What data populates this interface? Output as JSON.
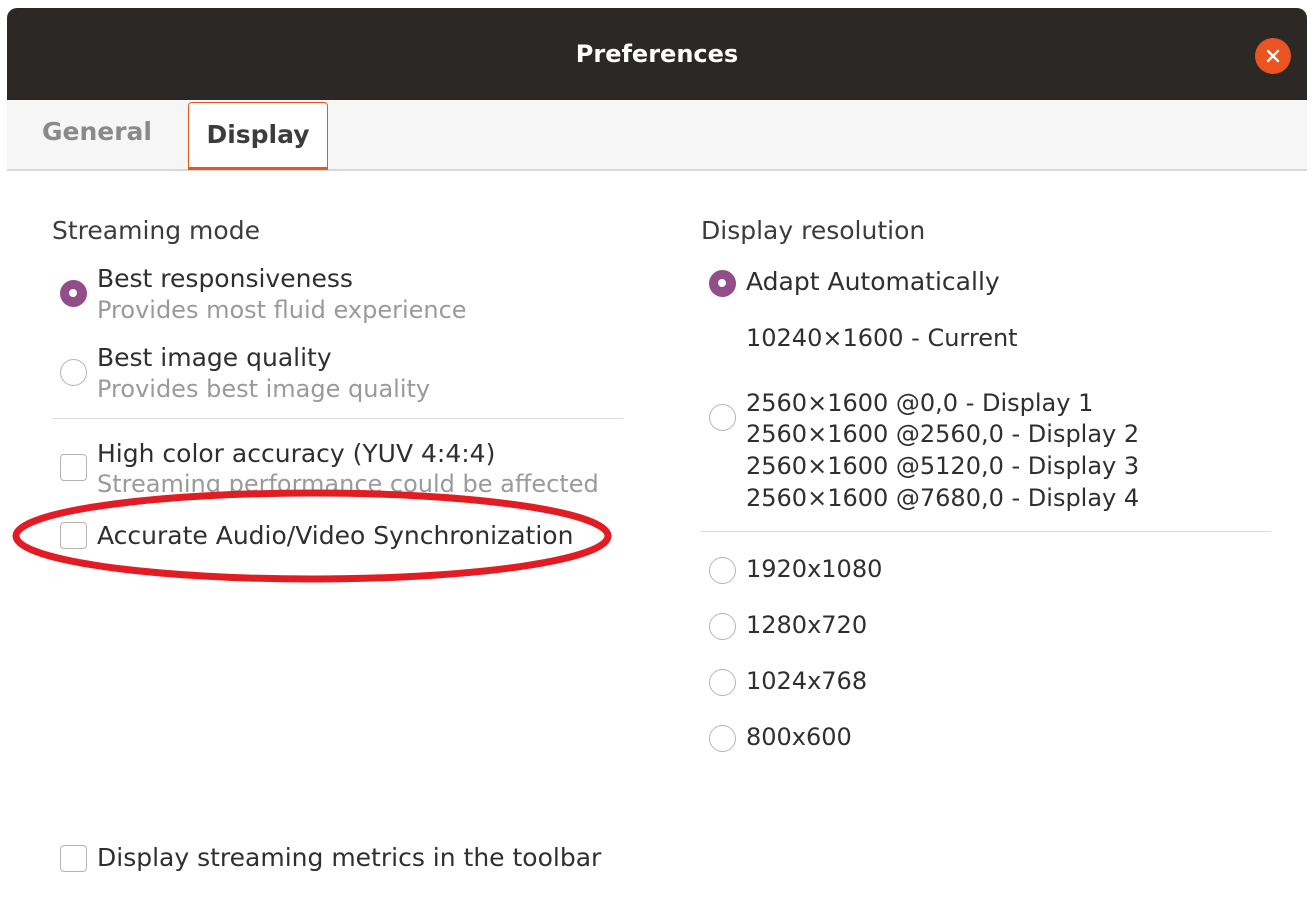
{
  "window": {
    "title": "Preferences",
    "close_icon": "close-icon"
  },
  "tabs": [
    {
      "label": "General",
      "active": false
    },
    {
      "label": "Display",
      "active": true
    }
  ],
  "streaming_mode": {
    "title": "Streaming mode",
    "options": [
      {
        "label": "Best responsiveness",
        "description": "Provides most fluid experience",
        "selected": true
      },
      {
        "label": "Best image quality",
        "description": "Provides best image quality",
        "selected": false
      }
    ],
    "checkboxes": [
      {
        "label": "High color accuracy (YUV 4:4:4)",
        "description": "Streaming performance could be affected",
        "checked": false
      },
      {
        "label": "Accurate Audio/Video Synchronization",
        "checked": false
      }
    ]
  },
  "display_resolution": {
    "title": "Display resolution",
    "adapt": {
      "label": "Adapt Automatically",
      "selected": true,
      "current": "10240×1600 - Current"
    },
    "multi_display": {
      "selected": false,
      "lines": [
        "2560×1600 @0,0 - Display 1",
        "2560×1600 @2560,0 - Display 2",
        "2560×1600 @5120,0 - Display 3",
        "2560×1600 @7680,0 - Display 4"
      ]
    },
    "presets": [
      {
        "label": "1920x1080",
        "selected": false
      },
      {
        "label": "1280x720",
        "selected": false
      },
      {
        "label": "1024x768",
        "selected": false
      },
      {
        "label": "800x600",
        "selected": false
      }
    ]
  },
  "footer": {
    "metrics_checkbox": {
      "label": "Display streaming metrics in the toolbar",
      "checked": false
    }
  },
  "colors": {
    "accent": "#e95420",
    "radio_selected": "#924d8b",
    "titlebar": "#2c2826",
    "annotation": "#e31b23"
  }
}
